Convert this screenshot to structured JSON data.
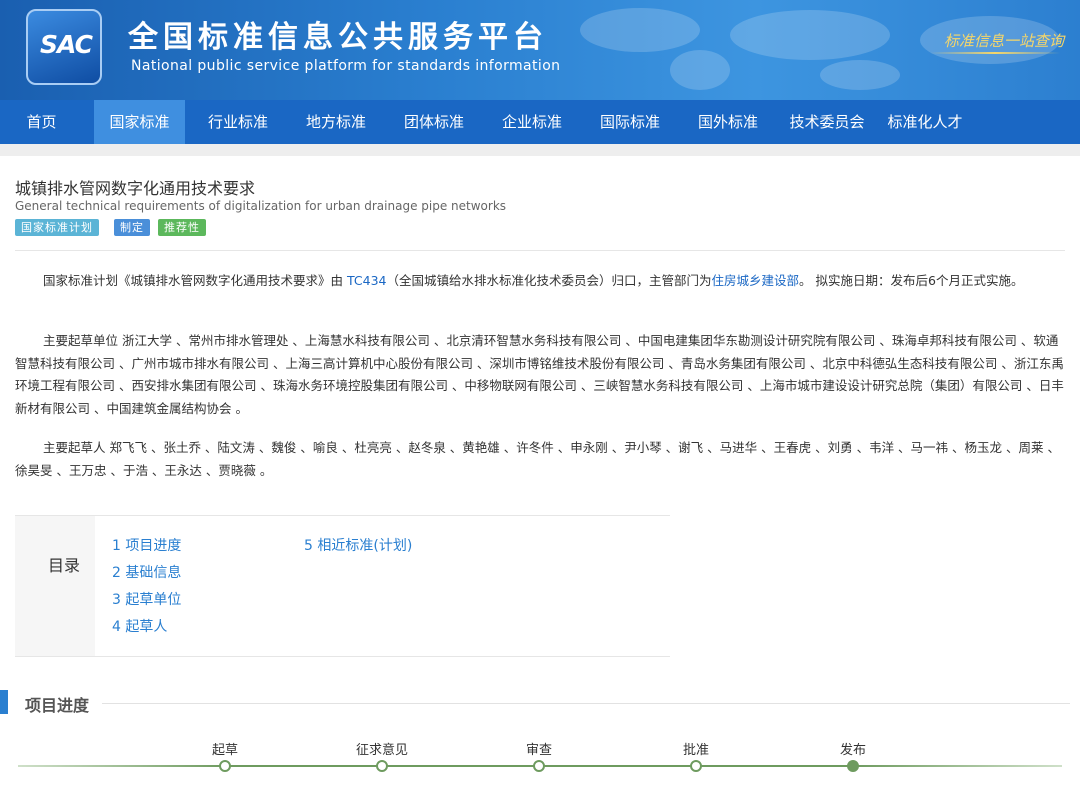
{
  "header": {
    "logo_text": "SAC",
    "title": "全国标准信息公共服务平台",
    "subtitle": "National public service platform  for standards information",
    "slogan": "标准信息一站查询"
  },
  "nav": [
    {
      "label": "首页",
      "active": false
    },
    {
      "label": "国家标准",
      "active": true
    },
    {
      "label": "行业标准",
      "active": false
    },
    {
      "label": "地方标准",
      "active": false
    },
    {
      "label": "团体标准",
      "active": false
    },
    {
      "label": "企业标准",
      "active": false
    },
    {
      "label": "国际标准",
      "active": false
    },
    {
      "label": "国外标准",
      "active": false
    },
    {
      "label": "技术委员会",
      "active": false
    },
    {
      "label": "标准化人才",
      "active": false
    }
  ],
  "standard": {
    "title": "城镇排水管网数字化通用技术要求",
    "title_en": "General technical requirements of digitalization for urban drainage pipe networks",
    "tags": [
      {
        "label": "国家标准计划",
        "color": "#5bb4d6"
      },
      {
        "label": "制定",
        "color": "#4a8fd9"
      },
      {
        "label": "推荐性",
        "color": "#5cb85c"
      }
    ]
  },
  "summary": {
    "p1_a": "国家标准计划《城镇排水管网数字化通用技术要求》由 ",
    "p1_tc": "TC434",
    "p1_b": "（全国城镇给水排水标准化技术委员会）归口，主管部门为",
    "p1_dept": "住房城乡建设部",
    "p1_c": "。 拟实施日期：发布后6个月正式实施。",
    "p2": "主要起草单位 浙江大学 、常州市排水管理处 、上海慧水科技有限公司 、北京清环智慧水务科技有限公司 、中国电建集团华东勘测设计研究院有限公司 、珠海卓邦科技有限公司 、软通智慧科技有限公司 、广州市城市排水有限公司 、上海三高计算机中心股份有限公司 、深圳市博铭维技术股份有限公司 、青岛水务集团有限公司 、北京中科德弘生态科技有限公司 、浙江东禹环境工程有限公司 、西安排水集团有限公司 、珠海水务环境控股集团有限公司 、中移物联网有限公司 、三峡智慧水务科技有限公司 、上海市城市建设设计研究总院（集团）有限公司 、日丰新材有限公司 、中国建筑金属结构协会 。",
    "p3": "主要起草人 郑飞飞 、张土乔 、陆文涛 、魏俊 、喻良 、杜亮亮 、赵冬泉 、黄艳雄 、许冬件 、申永刚 、尹小琴 、谢飞 、马进华 、王春虎 、刘勇 、韦洋 、马一祎 、杨玉龙 、周莱 、徐昊旻 、王万忠 、于浩 、王永达 、贾晓薇 。"
  },
  "toc": {
    "label": "目录",
    "items": [
      "1  项目进度",
      "2  基础信息",
      "3  起草单位",
      "4  起草人",
      "5  相近标准(计划)"
    ]
  },
  "progress": {
    "section_title": "项目进度",
    "steps": [
      {
        "label": "起草",
        "done": false
      },
      {
        "label": "征求意见",
        "done": false
      },
      {
        "label": "审查",
        "done": false
      },
      {
        "label": "批准",
        "done": false
      },
      {
        "label": "发布",
        "done": true
      }
    ]
  },
  "colors": {
    "nav_bg": "#1a67c4",
    "nav_active": "#3f8fe0",
    "link": "#1a67c4",
    "progress": "#6e9b5f"
  }
}
